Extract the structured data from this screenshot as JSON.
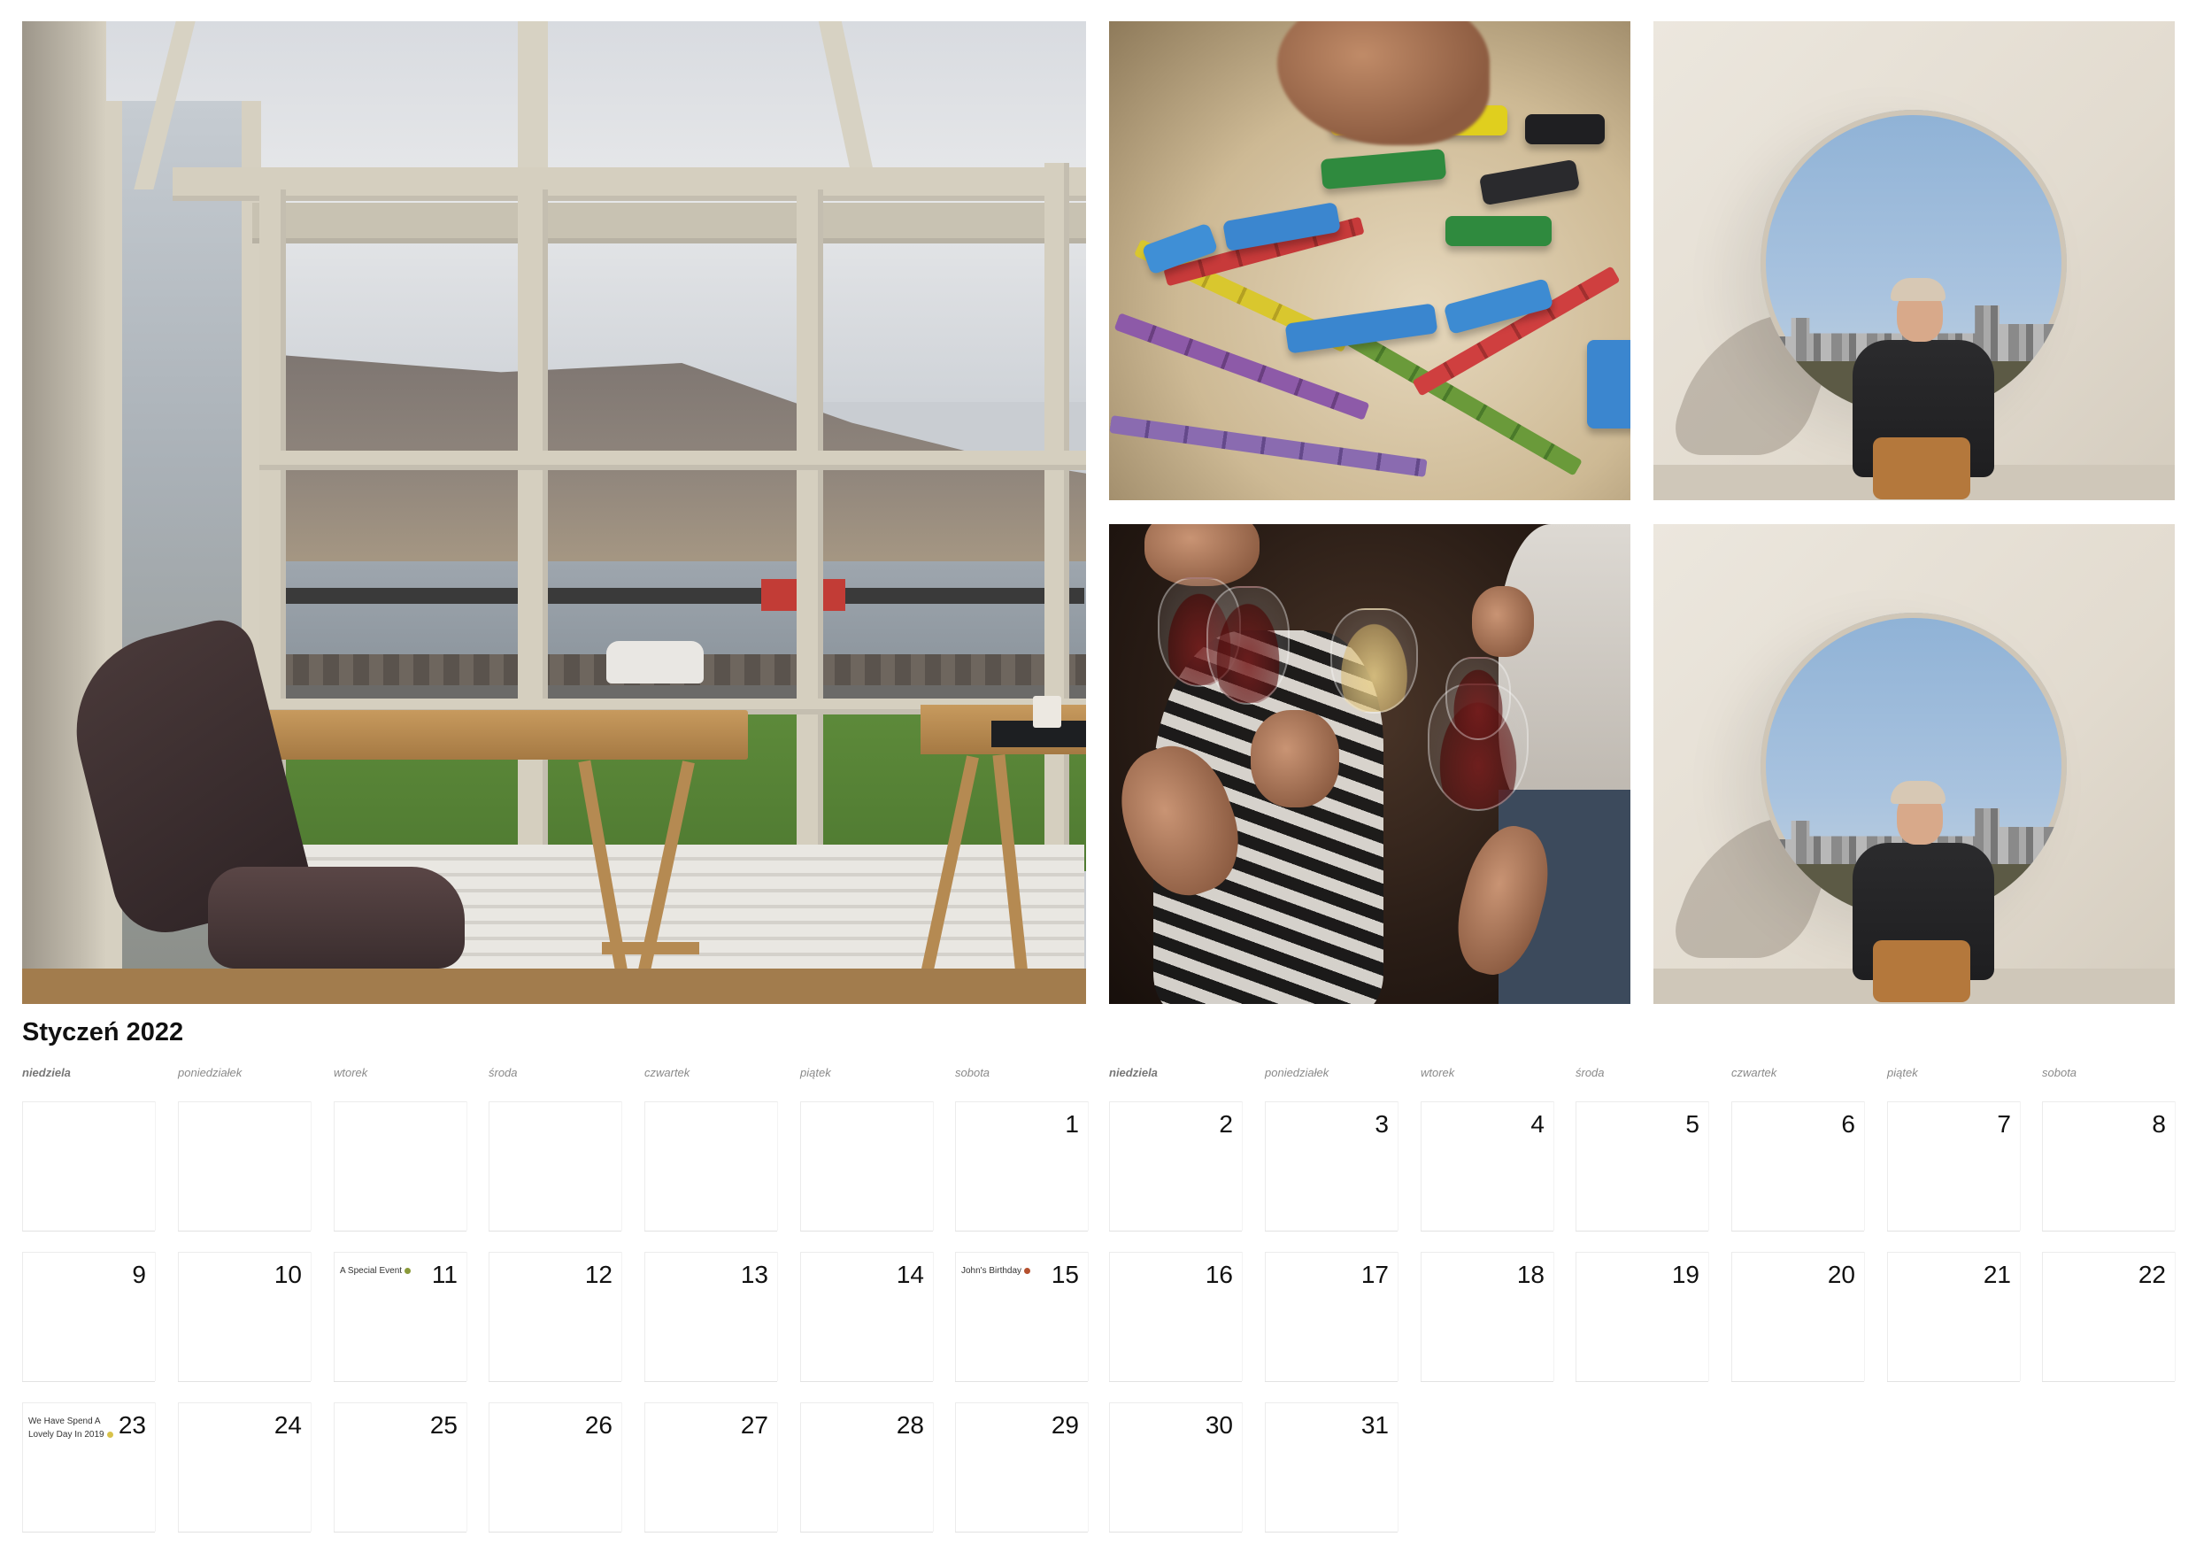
{
  "calendar": {
    "title": "Styczeń 2022",
    "weekdays": [
      "niedziela",
      "poniedziałek",
      "wtorek",
      "środa",
      "czwartek",
      "piątek",
      "sobota",
      "niedziela",
      "poniedziałek",
      "wtorek",
      "środa",
      "czwartek",
      "piątek",
      "sobota"
    ],
    "days": [
      "1",
      "2",
      "3",
      "4",
      "5",
      "6",
      "7",
      "8",
      "9",
      "10",
      "11",
      "12",
      "13",
      "14",
      "15",
      "16",
      "17",
      "18",
      "19",
      "20",
      "21",
      "22",
      "23",
      "24",
      "25",
      "26",
      "27",
      "28",
      "29",
      "30",
      "31"
    ],
    "events": {
      "e11": "A Special Event",
      "e15": "John's Birthday",
      "e23": "We Have Spend A Lovely Day In 2019"
    },
    "event_icons": {
      "e11": "leaf-icon",
      "e15": "balloon-icon",
      "e23": "sparkle-icon"
    },
    "event_colors": {
      "e11": "#8a9a3a",
      "e15": "#b5502e",
      "e23": "#d8c24a"
    }
  },
  "photos": {
    "p1": "sunroom-fjord-photo",
    "p2": "board-game-photo",
    "p3": "circle-wall-portrait-photo",
    "p4": "wine-toast-photo",
    "p5": "circle-wall-portrait-photo"
  }
}
